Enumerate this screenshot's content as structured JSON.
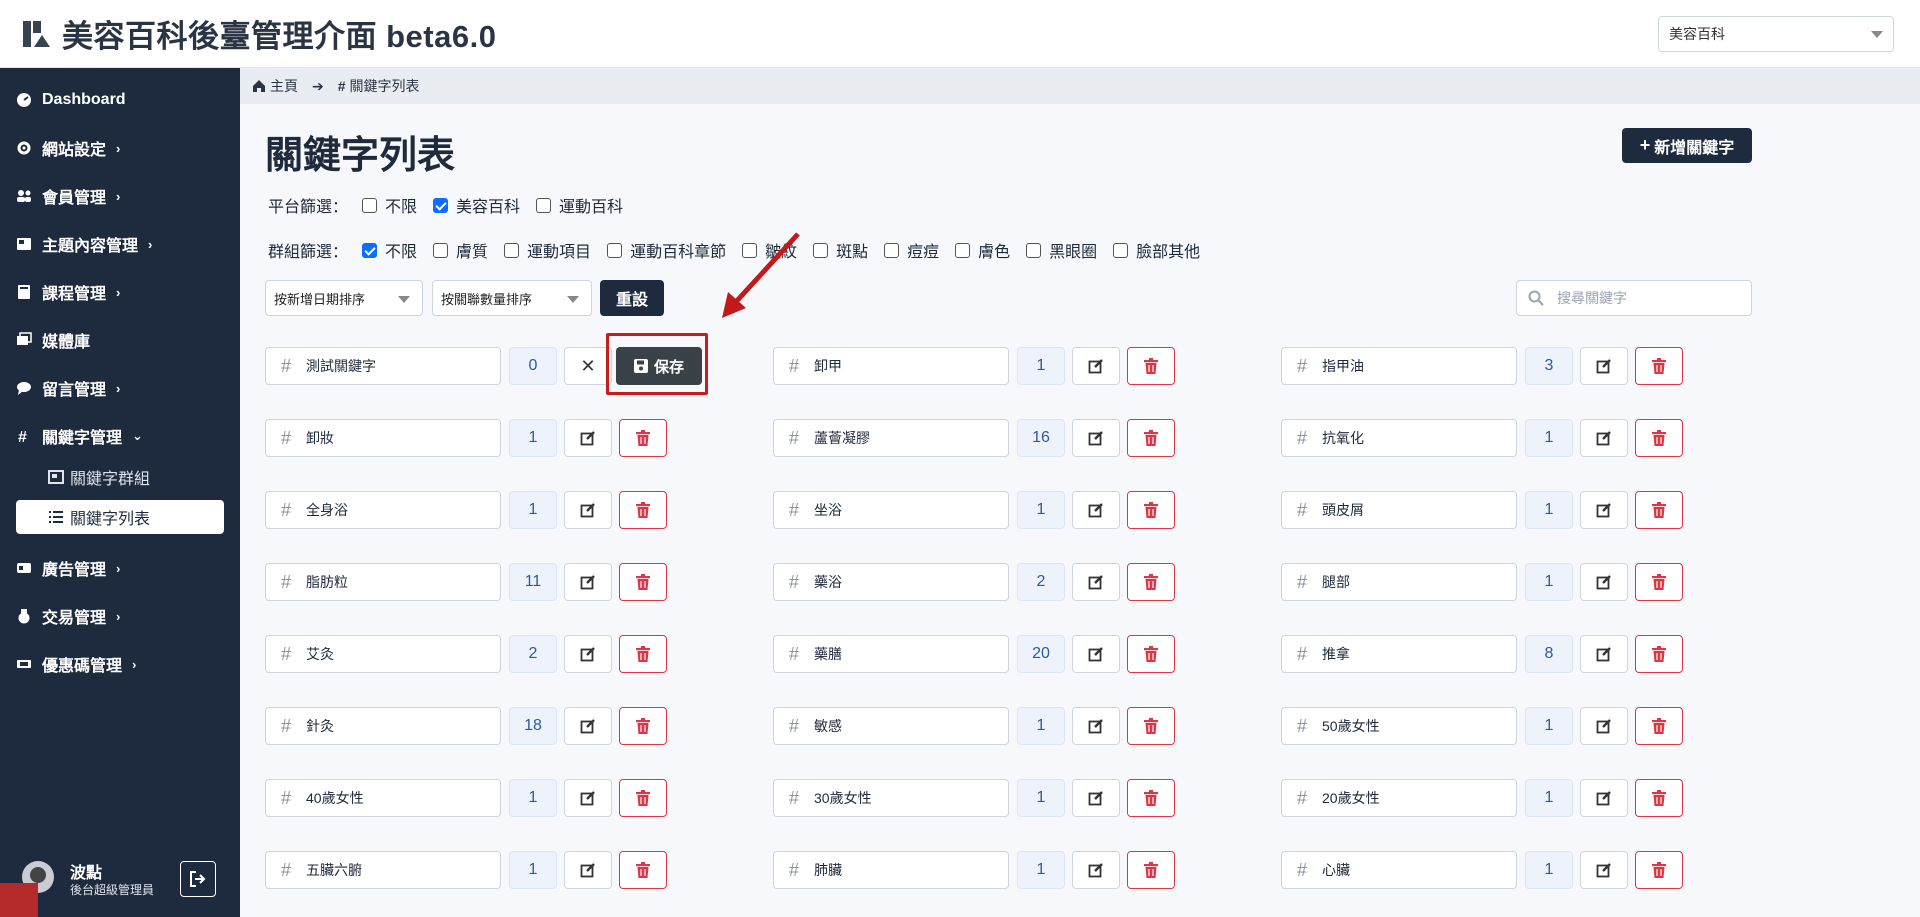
{
  "app": {
    "title": "美容百科後臺管理介面 beta6.0"
  },
  "site_select": {
    "value": "美容百科"
  },
  "sidebar": {
    "items": [
      {
        "label": "Dashboard",
        "icon": "dashboard-icon",
        "has_children": false
      },
      {
        "label": "網站設定",
        "icon": "gear-icon",
        "has_children": true
      },
      {
        "label": "會員管理",
        "icon": "users-icon",
        "has_children": true
      },
      {
        "label": "主題內容管理",
        "icon": "newspaper-icon",
        "has_children": true
      },
      {
        "label": "課程管理",
        "icon": "book-icon",
        "has_children": true
      },
      {
        "label": "媒體庫",
        "icon": "images-icon",
        "has_children": false
      },
      {
        "label": "留言管理",
        "icon": "comment-icon",
        "has_children": true
      },
      {
        "label": "關鍵字管理",
        "icon": "hashtag-icon",
        "has_children": true,
        "expanded": true
      },
      {
        "label": "廣告管理",
        "icon": "ad-icon",
        "has_children": true
      },
      {
        "label": "交易管理",
        "icon": "money-bag-icon",
        "has_children": true
      },
      {
        "label": "優惠碼管理",
        "icon": "ticket-icon",
        "has_children": true
      }
    ],
    "sub_items": [
      {
        "label": "關鍵字群組",
        "icon": "image-group-icon",
        "active": false
      },
      {
        "label": "關鍵字列表",
        "icon": "list-icon",
        "active": true
      }
    ],
    "user": {
      "name": "波點",
      "role": "後台超級管理員"
    }
  },
  "breadcrumb": {
    "home": "主頁",
    "current": "關鍵字列表"
  },
  "page": {
    "title": "關鍵字列表",
    "add_button": "新增關鍵字"
  },
  "platform_filter": {
    "label": "平台篩選：",
    "options": [
      {
        "label": "不限",
        "checked": false
      },
      {
        "label": "美容百科",
        "checked": true
      },
      {
        "label": "運動百科",
        "checked": false
      }
    ]
  },
  "group_filter": {
    "label": "群組篩選：",
    "options": [
      {
        "label": "不限",
        "checked": true
      },
      {
        "label": "膚質",
        "checked": false
      },
      {
        "label": "運動項目",
        "checked": false
      },
      {
        "label": "運動百科章節",
        "checked": false
      },
      {
        "label": "皺紋",
        "checked": false
      },
      {
        "label": "斑點",
        "checked": false
      },
      {
        "label": "痘痘",
        "checked": false
      },
      {
        "label": "膚色",
        "checked": false
      },
      {
        "label": "黑眼圈",
        "checked": false
      },
      {
        "label": "臉部其他",
        "checked": false
      }
    ]
  },
  "sort": {
    "date": "按新增日期排序",
    "count": "按關聯數量排序",
    "reset": "重設"
  },
  "search": {
    "placeholder": "搜尋關鍵字"
  },
  "editing": {
    "save_label": "保存"
  },
  "keywords": [
    [
      {
        "name": "測試關鍵字",
        "count": "0",
        "editing": true
      },
      {
        "name": "卸甲",
        "count": "1"
      },
      {
        "name": "指甲油",
        "count": "3"
      }
    ],
    [
      {
        "name": "卸妝",
        "count": "1"
      },
      {
        "name": "蘆薈凝膠",
        "count": "16"
      },
      {
        "name": "抗氧化",
        "count": "1"
      }
    ],
    [
      {
        "name": "全身浴",
        "count": "1"
      },
      {
        "name": "坐浴",
        "count": "1"
      },
      {
        "name": "頭皮屑",
        "count": "1"
      }
    ],
    [
      {
        "name": "脂肪粒",
        "count": "11"
      },
      {
        "name": "藥浴",
        "count": "2"
      },
      {
        "name": "腿部",
        "count": "1"
      }
    ],
    [
      {
        "name": "艾灸",
        "count": "2"
      },
      {
        "name": "藥膳",
        "count": "20"
      },
      {
        "name": "推拿",
        "count": "8"
      }
    ],
    [
      {
        "name": "針灸",
        "count": "18"
      },
      {
        "name": "敏感",
        "count": "1"
      },
      {
        "name": "50歲女性",
        "count": "1"
      }
    ],
    [
      {
        "name": "40歲女性",
        "count": "1"
      },
      {
        "name": "30歲女性",
        "count": "1"
      },
      {
        "name": "20歲女性",
        "count": "1"
      }
    ],
    [
      {
        "name": "五臟六腑",
        "count": "1"
      },
      {
        "name": "肺臟",
        "count": "1"
      },
      {
        "name": "心臟",
        "count": "1"
      }
    ]
  ],
  "colors": {
    "sidebar_bg": "#1e2a3e",
    "danger": "#dc3545",
    "highlight": "#c91d1d",
    "accent": "#0d6efd"
  }
}
